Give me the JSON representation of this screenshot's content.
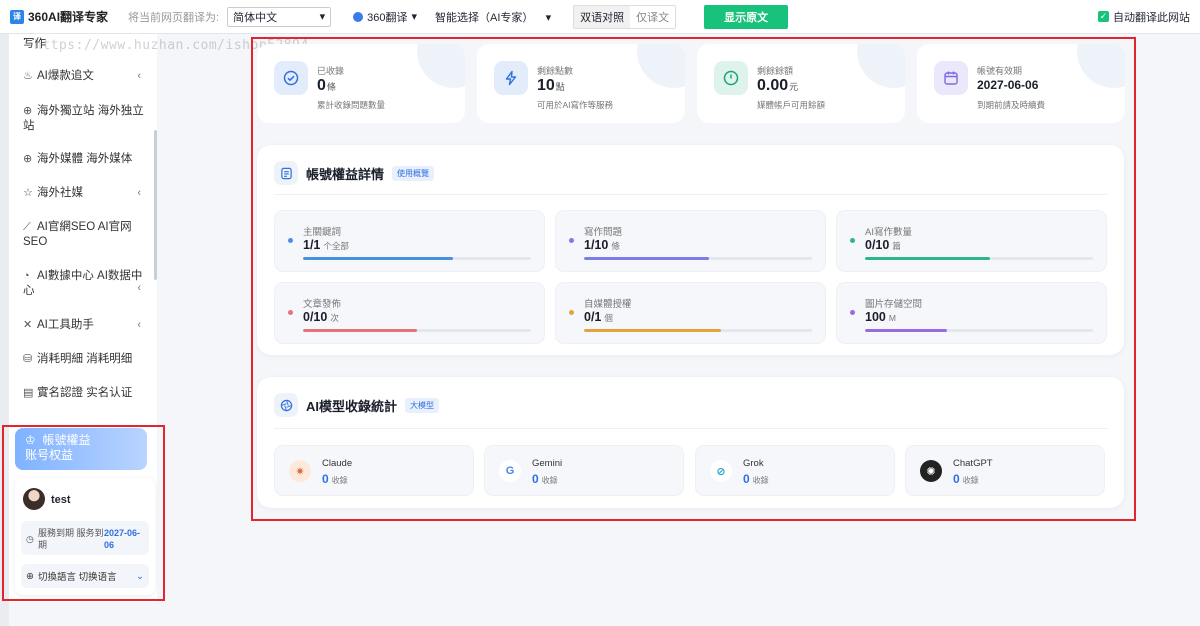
{
  "toolbar": {
    "app_name": "360AI翻译专家",
    "prompt": "将当前网页翻译为:",
    "target_lang": "简体中文",
    "engine": "360翻译",
    "mode": "智能选择（AI专家）",
    "bilingual": "双语对照",
    "translation_only": "仅译文",
    "show_original": "显示原文",
    "auto_translate": "自动翻译此网站"
  },
  "watermark": "https://www.huzhan.com/ishop52894",
  "sidebar": {
    "items": [
      {
        "label": "写作",
        "icon": "pen-icon"
      },
      {
        "label": "AI爆款追文",
        "icon": "fire-icon"
      },
      {
        "label": "海外獨立站 海外独立站",
        "icon": "globe-icon"
      },
      {
        "label": "海外媒體 海外媒体",
        "icon": "globe-icon"
      },
      {
        "label": "海外社媒",
        "icon": "star-icon"
      },
      {
        "label": "AI官網SEO AI官网SEO",
        "icon": "chart-icon"
      },
      {
        "label": "AI數據中心 AI数据中心",
        "icon": "pie-icon"
      },
      {
        "label": "AI工具助手",
        "icon": "tool-icon"
      },
      {
        "label": "消耗明細 消耗明细",
        "icon": "database-icon"
      },
      {
        "label": "實名認證 实名认证",
        "icon": "id-card-icon"
      }
    ],
    "active": {
      "line1": "帳號權益",
      "line2": "账号权益"
    }
  },
  "user": {
    "name": "test",
    "expiry_label": "服務到期 服务到期",
    "expiry_value": "2027-06-06",
    "lang_label": "切換語言 切换语言"
  },
  "stats": [
    {
      "label": "已收錄",
      "value": "0",
      "unit": "條",
      "sub": "累計收錄問題數量",
      "color": "#2f6fe0",
      "bg": "#e3ecfb"
    },
    {
      "label": "剩餘點數",
      "value": "10",
      "unit": "點",
      "sub": "可用於AI寫作等服務",
      "color": "#2f6fe0",
      "bg": "#e3ecfb"
    },
    {
      "label": "剩餘餘額",
      "value": "0.00",
      "unit": "元",
      "sub": "媒體帳戶可用餘額",
      "color": "#1aa37a",
      "bg": "#ddf3ec"
    },
    {
      "label": "帳號有效期",
      "value": "2027-06-06",
      "unit": "",
      "sub": "到期前請及時續費",
      "color": "#7c6be0",
      "bg": "#ebe8fb"
    }
  ],
  "benefits": {
    "title": "帳號權益詳情",
    "tag": "使用概覽",
    "items": [
      {
        "label": "主關鍵詞",
        "value": "1/1",
        "unit": "个全部",
        "color": "#4a90e2",
        "progress": 0.66
      },
      {
        "label": "寫作問題",
        "value": "1/10",
        "unit": "條",
        "color": "#7c7ce8",
        "progress": 0.55
      },
      {
        "label": "AI寫作數量",
        "value": "0/10",
        "unit": "篇",
        "color": "#2fb58a",
        "progress": 0.55
      },
      {
        "label": "文章發佈",
        "value": "0/10",
        "unit": "次",
        "color": "#e8727b",
        "progress": 0.5
      },
      {
        "label": "自媒體授權",
        "value": "0/1",
        "unit": "個",
        "color": "#e6a23c",
        "progress": 0.6
      },
      {
        "label": "圖片存儲空間",
        "value": "100",
        "unit": "M",
        "color": "#9a6be0",
        "progress": 0.36
      }
    ]
  },
  "models": {
    "title": "AI模型收錄統計",
    "tag": "大模型",
    "items": [
      {
        "name": "Claude",
        "count": "0",
        "unit": "收錄",
        "icon": "claude-icon"
      },
      {
        "name": "Gemini",
        "count": "0",
        "unit": "收錄",
        "icon": "google-icon"
      },
      {
        "name": "Grok",
        "count": "0",
        "unit": "收錄",
        "icon": "grok-icon"
      },
      {
        "name": "ChatGPT",
        "count": "0",
        "unit": "收錄",
        "icon": "chatgpt-icon"
      }
    ]
  }
}
